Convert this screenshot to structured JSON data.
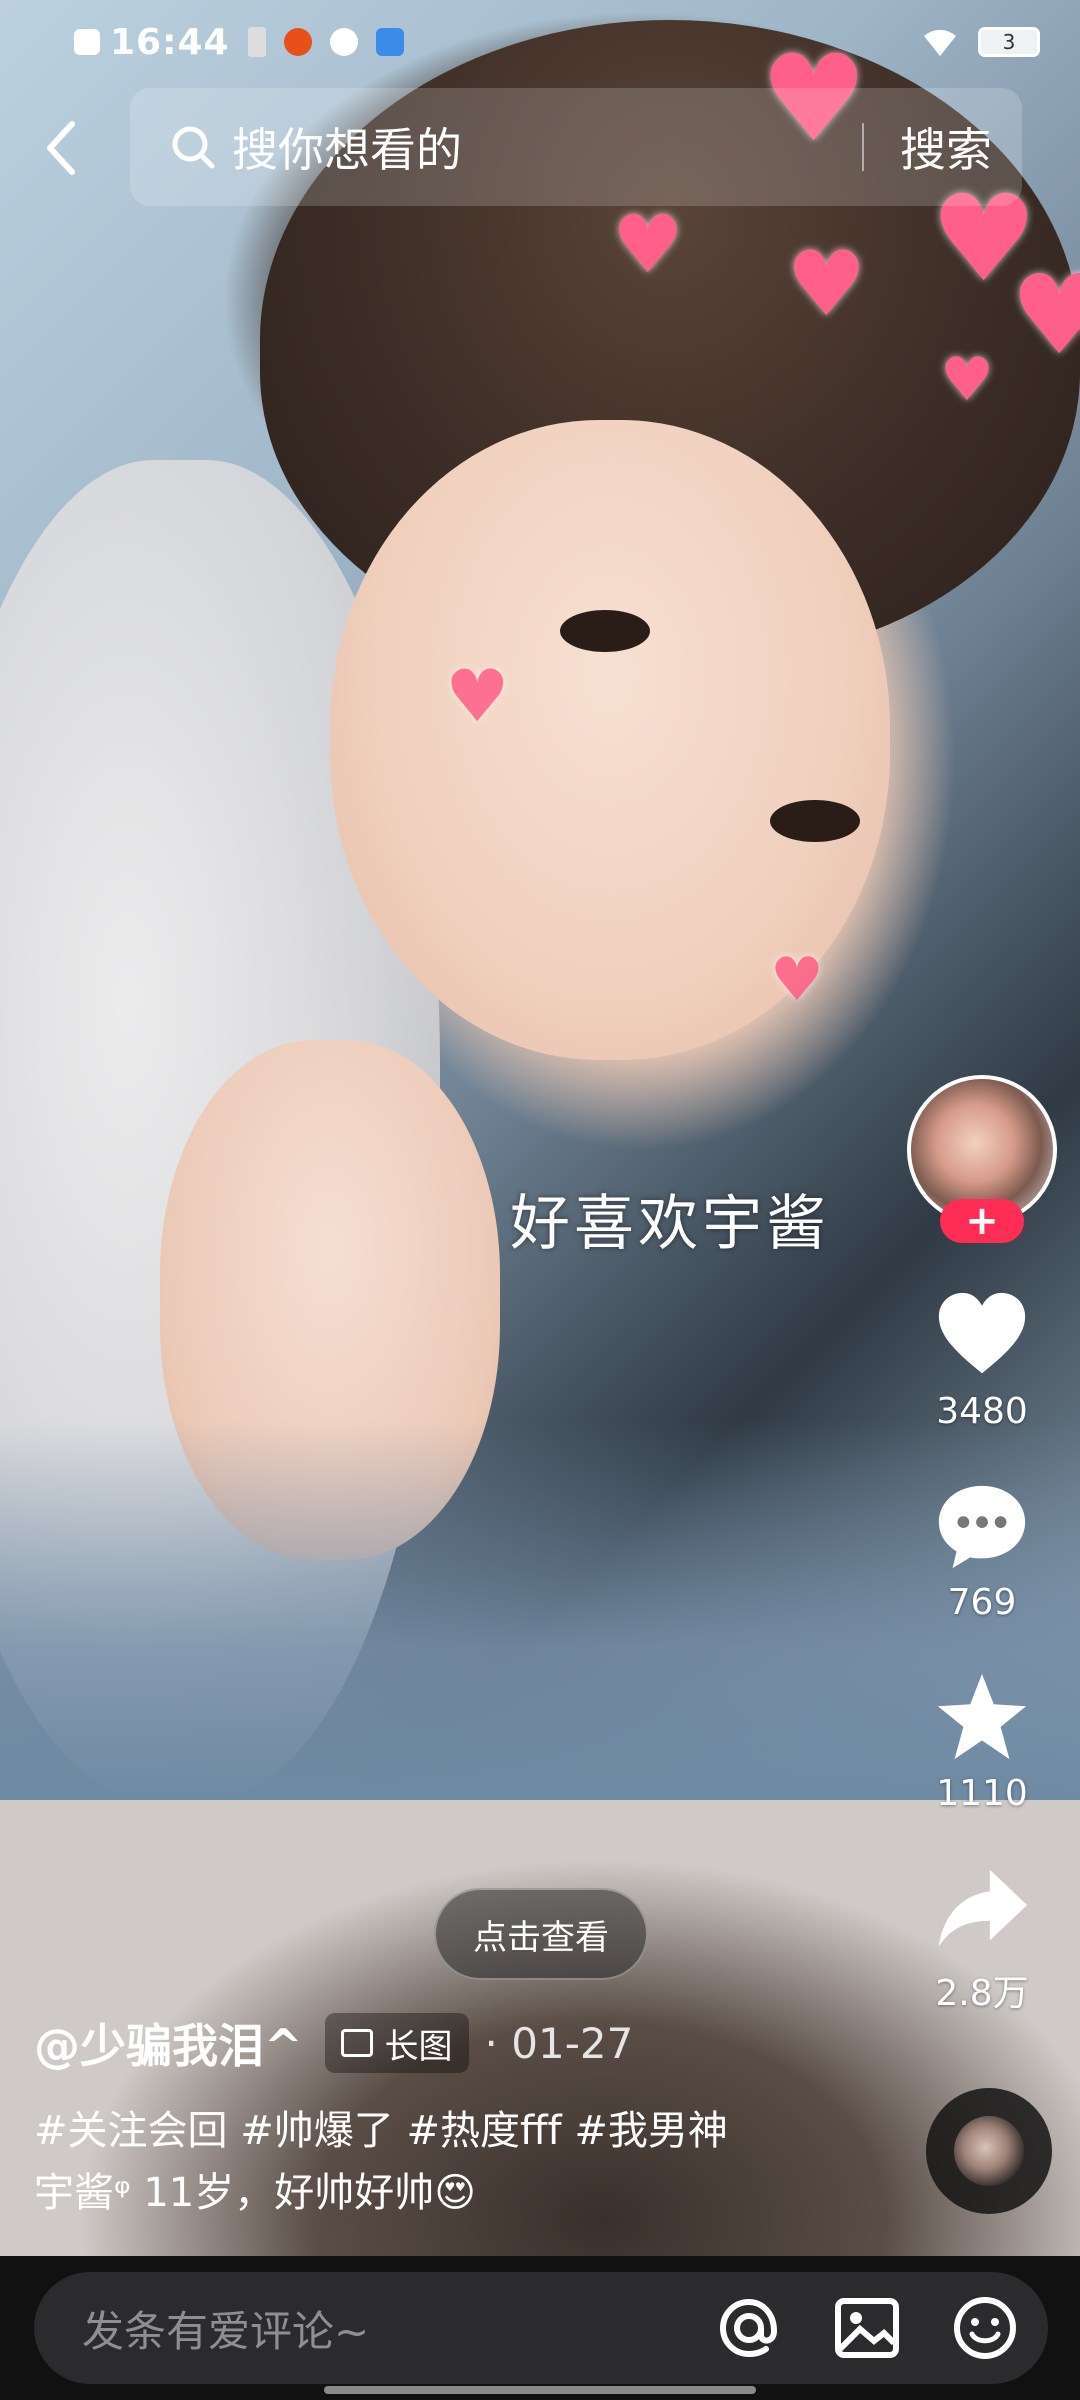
{
  "status_bar": {
    "time": "16:44",
    "battery_level": "3",
    "icons": [
      "notification-icon",
      "battery-saver-icon",
      "app-icon-1",
      "app-icon-2",
      "app-icon-3",
      "wifi-icon"
    ]
  },
  "search": {
    "placeholder": "搜你想看的",
    "button_label": "搜索"
  },
  "post": {
    "overlay_text": "好喜欢宇酱",
    "view_button": "点击查看",
    "author": "@少骗我泪^",
    "type_tag": "长图",
    "date": "· 01-27",
    "description": "#关注会回 #帅爆了 #热度fff #我男神 宇酱ᵠ 11岁，好帅好帅😍"
  },
  "actions": {
    "follow_label": "+",
    "likes": "3480",
    "comments": "769",
    "favorites": "1110",
    "shares": "2.8万"
  },
  "comment_bar": {
    "placeholder": "发条有爱评论~"
  },
  "colors": {
    "accent": "#ff2c55",
    "heart": "#ff5f88",
    "bottom_bar": "#111111",
    "input_bg": "#2b2b2e"
  }
}
